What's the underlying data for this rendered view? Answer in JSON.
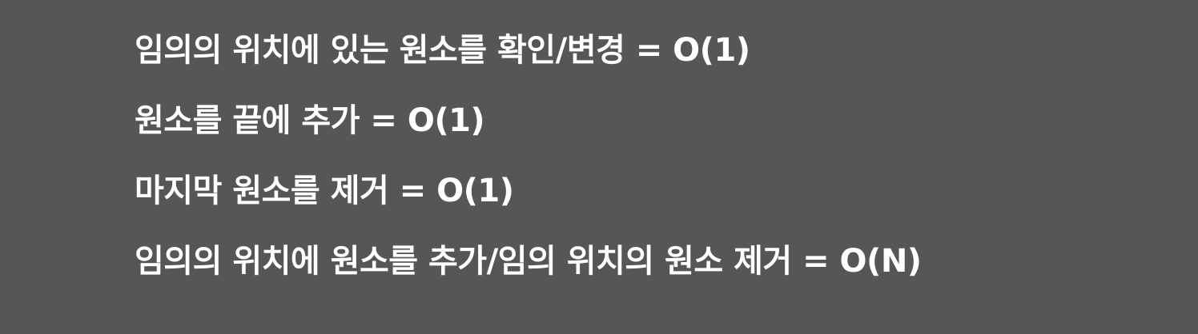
{
  "lines": [
    "임의의 위치에 있는 원소를 확인/변경 = O(1)",
    "원소를 끝에 추가 = O(1)",
    "마지막 원소를 제거 = O(1)",
    "임의의 위치에 원소를 추가/임의 위치의 원소 제거 = O(N)"
  ],
  "colors": {
    "background": "#575556",
    "text": "#ffffff"
  }
}
